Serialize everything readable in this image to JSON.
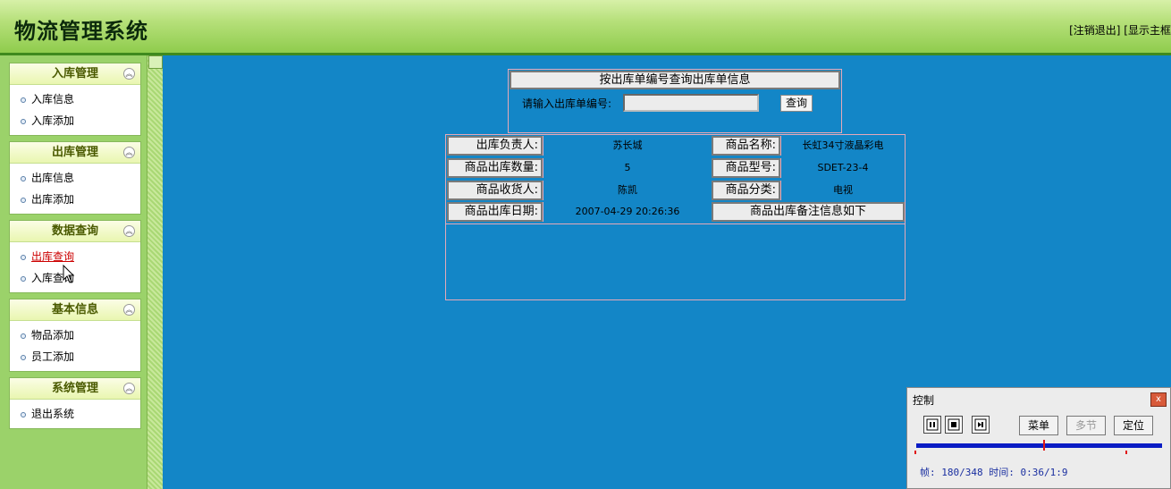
{
  "header": {
    "title": "物流管理系统",
    "links": "[注销退出] [显示主框"
  },
  "sidebar": {
    "groups": [
      {
        "title": "入库管理",
        "items": [
          "入库信息",
          "入库添加"
        ]
      },
      {
        "title": "出库管理",
        "items": [
          "出库信息",
          "出库添加"
        ]
      },
      {
        "title": "数据查询",
        "items": [
          "出库查询",
          "入库查询"
        ]
      },
      {
        "title": "基本信息",
        "items": [
          "物品添加",
          "员工添加"
        ]
      },
      {
        "title": "系统管理",
        "items": [
          "退出系统"
        ]
      }
    ],
    "active_item": "出库查询"
  },
  "search": {
    "title": "按出库单编号查询出库单信息",
    "label": "请输入出库单编号:",
    "value": "",
    "button": "查询"
  },
  "detail": {
    "rows": [
      {
        "label1": "出库负责人:",
        "value1": "苏长城",
        "label2": "商品名称:",
        "value2": "长虹34寸液晶彩电"
      },
      {
        "label1": "商品出库数量:",
        "value1": "5",
        "label2": "商品型号:",
        "value2": "SDET-23-4"
      },
      {
        "label1": "商品收货人:",
        "value1": "陈凯",
        "label2": "商品分类:",
        "value2": "电视"
      },
      {
        "label1": "商品出库日期:",
        "value1": "2007-04-29 20:26:36"
      }
    ],
    "remarks_header": "商品出库备注信息如下",
    "remarks": ""
  },
  "control": {
    "title": "控制",
    "close": "x",
    "pause_icon": "pause-icon",
    "stop_icon": "stop-icon",
    "step_icon": "step-forward-icon",
    "menu": "菜单",
    "multi": "多节",
    "locate": "定位",
    "frame_text": "帧: 180/348 时间: 0:36/1:9",
    "progress_fraction": 0.517
  },
  "colors": {
    "main_bg": "#1386c7",
    "sidebar_bg": "#9bd26a",
    "header_bg": "#8fcc4d",
    "active_link": "#cc0000"
  }
}
